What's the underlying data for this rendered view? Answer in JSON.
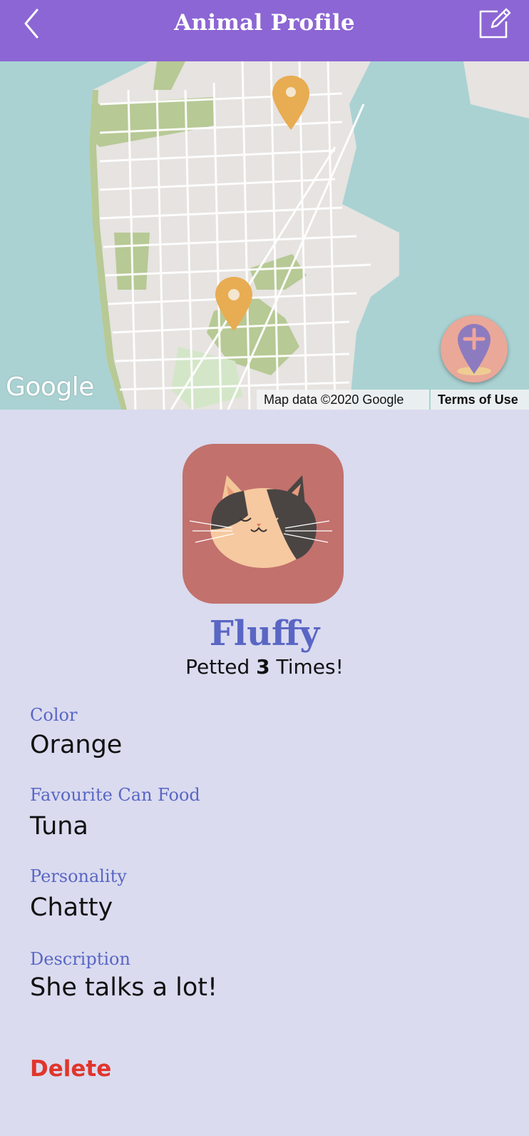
{
  "header": {
    "title": "Animal Profile",
    "back_icon": "chevron-left-icon",
    "edit_icon": "edit-icon",
    "background": "#8c66d4"
  },
  "map": {
    "logo_text": "Google",
    "attribution": "Map data ©2020 Google",
    "terms_label": "Terms of Use",
    "marker_color": "#e8ac52",
    "add_pin_icon": "add-location-icon"
  },
  "profile": {
    "name": "Fluffy",
    "petted_prefix": "Petted ",
    "petted_count": "3",
    "petted_suffix": " Times!",
    "accent_color": "#5966c4"
  },
  "fields": {
    "color": {
      "label": "Color",
      "value": "Orange"
    },
    "food": {
      "label": "Favourite Can Food",
      "value": "Tuna"
    },
    "personality": {
      "label": "Personality",
      "value": "Chatty"
    },
    "description": {
      "label": "Description",
      "value": "She talks a lot!"
    }
  },
  "actions": {
    "delete_label": "Delete",
    "delete_color": "#e1352c"
  }
}
